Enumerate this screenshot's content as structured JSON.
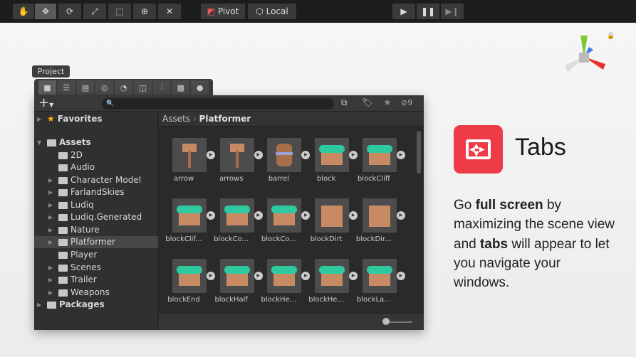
{
  "toolbar": {
    "tools": [
      "hand-tool",
      "move-tool",
      "rotate-tool",
      "scale-tool",
      "rect-tool",
      "transform-tool",
      "custom-tool"
    ],
    "pivot": "Pivot",
    "local": "Local"
  },
  "project": {
    "title": "Project",
    "search_placeholder": "",
    "hidden_count": "9",
    "tree": {
      "favorites": "Favorites",
      "assets": "Assets",
      "folders": [
        "2D",
        "Audio",
        "Character Model",
        "FarlandSkies",
        "Ludiq",
        "Ludiq.Generated",
        "Nature",
        "Platformer",
        "Player",
        "Scenes",
        "Trailer",
        "Weapons"
      ],
      "selected": "Platformer",
      "packages": "Packages"
    },
    "breadcrumb": {
      "root": "Assets",
      "current": "Platformer"
    },
    "items": [
      "arrow",
      "arrows",
      "barrel",
      "block",
      "blockCliff",
      "blockClif...",
      "blockCo...",
      "blockCo...",
      "blockDirt",
      "blockDir...",
      "blockEnd",
      "blockHalf",
      "blockHe...",
      "blockHe...",
      "blockLa..."
    ]
  },
  "callout": {
    "title": "Tabs",
    "text_before": "Go ",
    "bold1": "full screen",
    "text_mid": " by maximizing the scene view and ",
    "bold2": "tabs",
    "text_after": " will appear to let you navigate your windows."
  },
  "colors": {
    "accent": "#ee3b48",
    "grass": "#2fc9a0",
    "dirt": "#c88a62"
  }
}
